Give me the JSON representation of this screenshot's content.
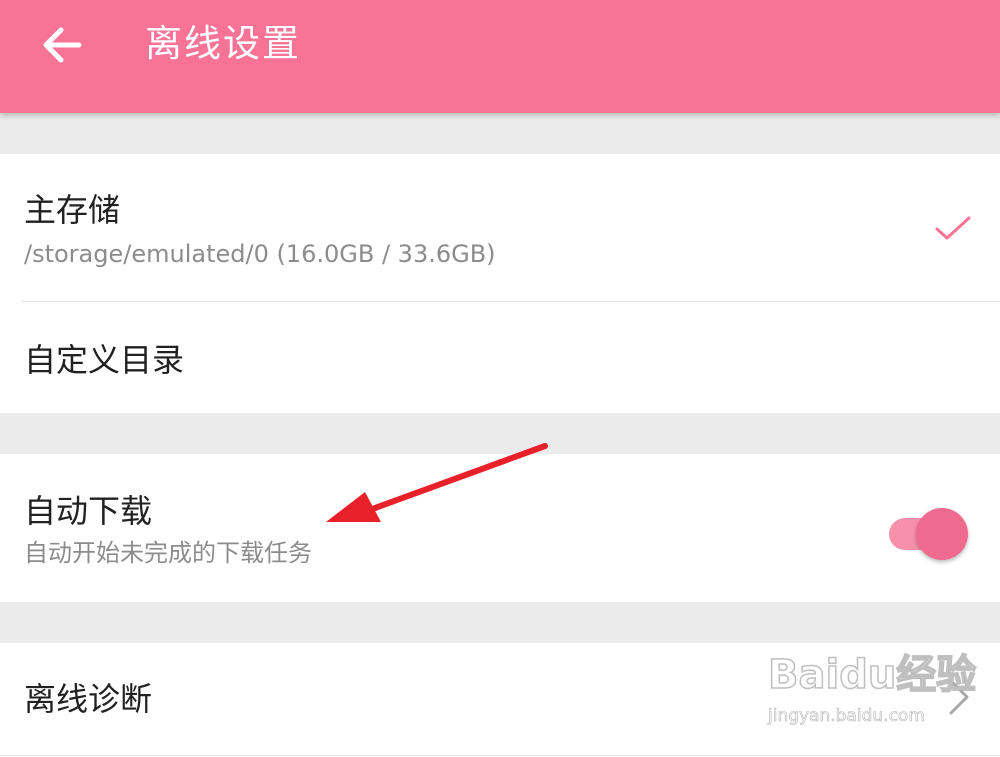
{
  "appbar": {
    "back_icon": "arrow-left-icon",
    "title": "离线设置",
    "color": "#f87395"
  },
  "storage": {
    "primary": {
      "title": "主存储",
      "subtitle": "/storage/emulated/0 (16.0GB / 33.6GB)",
      "selected": true,
      "icon": "check-icon"
    },
    "custom": {
      "title": "自定义目录"
    }
  },
  "auto_download": {
    "title": "自动下载",
    "subtitle": "自动开始未完成的下载任务",
    "enabled": true
  },
  "diagnosis": {
    "title": "离线诊断",
    "icon": "chevron-right-icon"
  },
  "annotation": {
    "type": "red-arrow",
    "color": "#e8202a"
  },
  "watermark": {
    "logo": "Baidu经验",
    "url": "jingyan.baidu.com"
  }
}
